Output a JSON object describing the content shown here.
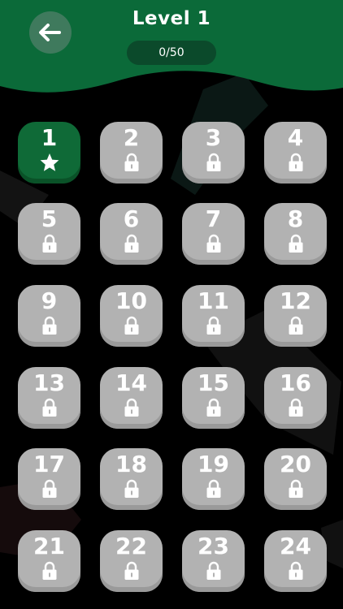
{
  "header": {
    "title": "Level 1",
    "progress": "0/50",
    "back_icon": "arrow-left-icon"
  },
  "colors": {
    "header_green": "#0b6a39",
    "unlocked_tile": "#0f6a37",
    "locked_tile": "#b2b2b2",
    "background": "#000000"
  },
  "levels": [
    {
      "number": "1",
      "state": "unlocked",
      "icon": "star-icon"
    },
    {
      "number": "2",
      "state": "locked",
      "icon": "lock-icon"
    },
    {
      "number": "3",
      "state": "locked",
      "icon": "lock-icon"
    },
    {
      "number": "4",
      "state": "locked",
      "icon": "lock-icon"
    },
    {
      "number": "5",
      "state": "locked",
      "icon": "lock-icon"
    },
    {
      "number": "6",
      "state": "locked",
      "icon": "lock-icon"
    },
    {
      "number": "7",
      "state": "locked",
      "icon": "lock-icon"
    },
    {
      "number": "8",
      "state": "locked",
      "icon": "lock-icon"
    },
    {
      "number": "9",
      "state": "locked",
      "icon": "lock-icon"
    },
    {
      "number": "10",
      "state": "locked",
      "icon": "lock-icon"
    },
    {
      "number": "11",
      "state": "locked",
      "icon": "lock-icon"
    },
    {
      "number": "12",
      "state": "locked",
      "icon": "lock-icon"
    },
    {
      "number": "13",
      "state": "locked",
      "icon": "lock-icon"
    },
    {
      "number": "14",
      "state": "locked",
      "icon": "lock-icon"
    },
    {
      "number": "15",
      "state": "locked",
      "icon": "lock-icon"
    },
    {
      "number": "16",
      "state": "locked",
      "icon": "lock-icon"
    },
    {
      "number": "17",
      "state": "locked",
      "icon": "lock-icon"
    },
    {
      "number": "18",
      "state": "locked",
      "icon": "lock-icon"
    },
    {
      "number": "19",
      "state": "locked",
      "icon": "lock-icon"
    },
    {
      "number": "20",
      "state": "locked",
      "icon": "lock-icon"
    },
    {
      "number": "21",
      "state": "locked",
      "icon": "lock-icon"
    },
    {
      "number": "22",
      "state": "locked",
      "icon": "lock-icon"
    },
    {
      "number": "23",
      "state": "locked",
      "icon": "lock-icon"
    },
    {
      "number": "24",
      "state": "locked",
      "icon": "lock-icon"
    }
  ]
}
